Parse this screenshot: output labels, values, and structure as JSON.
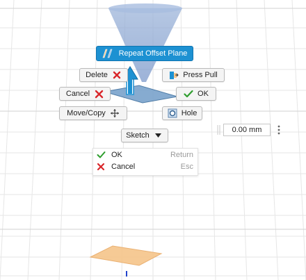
{
  "marking_menu": {
    "repeat_label": "Repeat Offset Plane",
    "delete_label": "Delete",
    "press_pull_label": "Press Pull",
    "cancel_label": "Cancel",
    "ok_label": "OK",
    "move_copy_label": "Move/Copy",
    "hole_label": "Hole",
    "sketch_label": "Sketch"
  },
  "context_menu": {
    "items": [
      {
        "label": "OK",
        "shortcut": "Return",
        "icon": "checkmark-icon"
      },
      {
        "label": "Cancel",
        "shortcut": "Esc",
        "icon": "cross-icon"
      }
    ]
  },
  "distance_input": {
    "value": "0.00 mm"
  },
  "icons": {
    "repeat": "offset-plane-icon",
    "delete": "red-x-icon",
    "press_pull": "press-pull-icon",
    "cancel": "red-x-icon",
    "ok": "green-checkmark-icon",
    "move_copy": "move-arrows-icon",
    "hole": "hole-icon",
    "sketch": "dropdown-triangle-icon",
    "drag": "drag-handle-icon",
    "more": "more-options-icon"
  },
  "colors": {
    "primary_blue": "#1d91d2",
    "ok_green": "#2e9e2e",
    "cancel_red": "#d9262a",
    "plane_orange": "#f6c58a",
    "grid": "#e4e4e4"
  }
}
